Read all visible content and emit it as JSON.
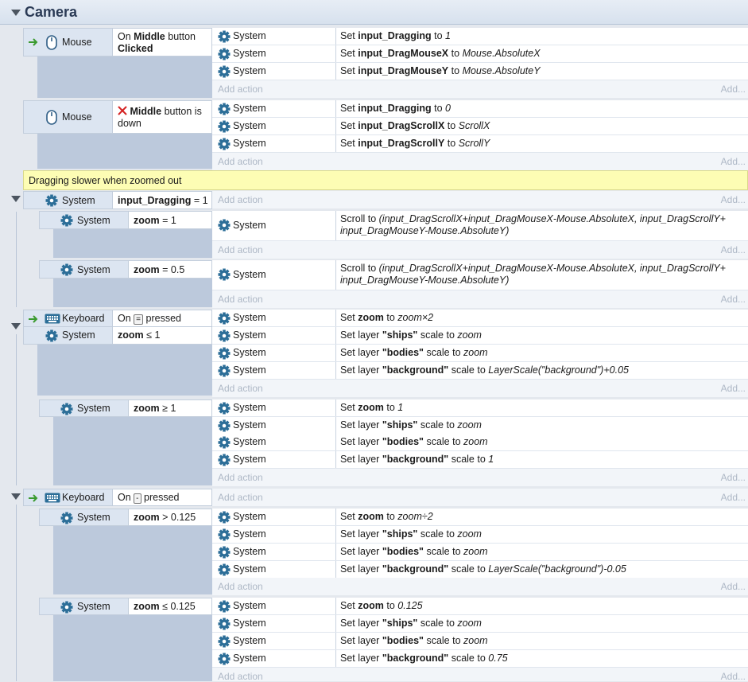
{
  "group": {
    "title": "Camera"
  },
  "common": {
    "system": "System",
    "mouse": "Mouse",
    "keyboard": "Keyboard",
    "add_action": "Add action",
    "add_more": "Add..."
  },
  "comment": "Dragging slower when zoomed out",
  "events": {
    "e1": {
      "cond": {
        "on": "On",
        "bold": "Middle",
        "rest": "button",
        "line2": "Clicked"
      },
      "actions": [
        {
          "pre": "Set",
          "var": "input_Dragging",
          "mid": "to",
          "val": "1"
        },
        {
          "pre": "Set",
          "var": "input_DragMouseX",
          "mid": "to",
          "val": "Mouse.AbsoluteX"
        },
        {
          "pre": "Set",
          "var": "input_DragMouseY",
          "mid": "to",
          "val": "Mouse.AbsoluteY"
        }
      ]
    },
    "e2": {
      "cond": {
        "bold": "Middle",
        "rest": "button is",
        "line2": "down"
      },
      "actions": [
        {
          "pre": "Set",
          "var": "input_Dragging",
          "mid": "to",
          "val": "0"
        },
        {
          "pre": "Set",
          "var": "input_DragScrollX",
          "mid": "to",
          "val": "ScrollX"
        },
        {
          "pre": "Set",
          "var": "input_DragScrollY",
          "mid": "to",
          "val": "ScrollY"
        }
      ]
    },
    "e3": {
      "cond": {
        "var": "input_Dragging",
        "op": "= 1"
      }
    },
    "e3a": {
      "cond": {
        "var": "zoom",
        "op": "= 1"
      },
      "action": {
        "pre": "Scroll to",
        "expr": "(input_DragScrollX+input_DragMouseX-Mouse.AbsoluteX, input_DragScrollY+ input_DragMouseY-Mouse.AbsoluteY)"
      }
    },
    "e3b": {
      "cond": {
        "var": "zoom",
        "op": "= 0.5"
      },
      "action": {
        "pre": "Scroll to",
        "expr": "(input_DragScrollX+input_DragMouseX-Mouse.AbsoluteX, input_DragScrollY+ input_DragMouseY-Mouse.AbsoluteY)"
      }
    },
    "e4": {
      "cond1": {
        "on": "On",
        "key": "=",
        "rest": "pressed"
      },
      "cond2": {
        "var": "zoom",
        "op": "≤ 1"
      },
      "actions": [
        {
          "pre": "Set",
          "var": "zoom",
          "mid": "to",
          "val": "zoom×2"
        },
        {
          "pre": "Set layer",
          "var": "\"ships\"",
          "mid": "scale to",
          "val": "zoom"
        },
        {
          "pre": "Set layer",
          "var": "\"bodies\"",
          "mid": "scale to",
          "val": "zoom"
        },
        {
          "pre": "Set layer",
          "var": "\"background\"",
          "mid": "scale to",
          "val": "LayerScale(\"background\")+0.05"
        }
      ]
    },
    "e5": {
      "cond": {
        "var": "zoom",
        "op": "≥ 1"
      },
      "actions": [
        {
          "pre": "Set",
          "var": "zoom",
          "mid": "to",
          "val": "1"
        },
        {
          "pre": "Set layer",
          "var": "\"ships\"",
          "mid": "scale to",
          "val": "zoom"
        },
        {
          "pre": "Set layer",
          "var": "\"bodies\"",
          "mid": "scale to",
          "val": "zoom"
        },
        {
          "pre": "Set layer",
          "var": "\"background\"",
          "mid": "scale to",
          "val": "1"
        }
      ]
    },
    "e6": {
      "cond": {
        "on": "On",
        "key": "-",
        "rest": "pressed"
      }
    },
    "e6a": {
      "cond": {
        "var": "zoom",
        "op": "> 0.125"
      },
      "actions": [
        {
          "pre": "Set",
          "var": "zoom",
          "mid": "to",
          "val": "zoom÷2"
        },
        {
          "pre": "Set layer",
          "var": "\"ships\"",
          "mid": "scale to",
          "val": "zoom"
        },
        {
          "pre": "Set layer",
          "var": "\"bodies\"",
          "mid": "scale to",
          "val": "zoom"
        },
        {
          "pre": "Set layer",
          "var": "\"background\"",
          "mid": "scale to",
          "val": "LayerScale(\"background\")-0.05"
        }
      ]
    },
    "e6b": {
      "cond": {
        "var": "zoom",
        "op": "≤ 0.125"
      },
      "actions": [
        {
          "pre": "Set",
          "var": "zoom",
          "mid": "to",
          "val": "0.125"
        },
        {
          "pre": "Set layer",
          "var": "\"ships\"",
          "mid": "scale to",
          "val": "zoom"
        },
        {
          "pre": "Set layer",
          "var": "\"bodies\"",
          "mid": "scale to",
          "val": "zoom"
        },
        {
          "pre": "Set layer",
          "var": "\"background\"",
          "mid": "scale to",
          "val": "0.75"
        }
      ]
    }
  }
}
